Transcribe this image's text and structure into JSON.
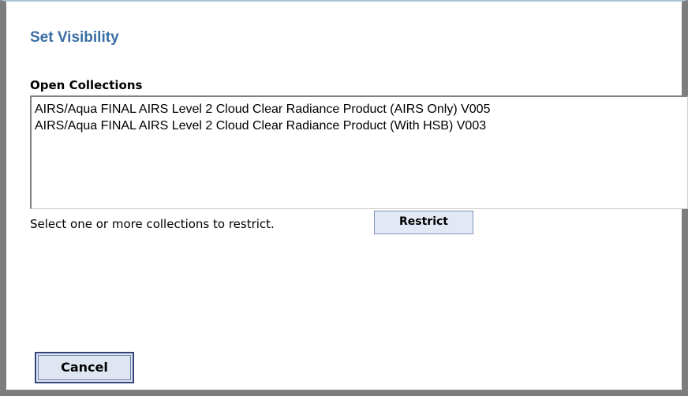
{
  "dialog": {
    "title": "Set Visibility"
  },
  "open_collections": {
    "label": "Open Collections",
    "items": [
      "AIRS/Aqua FINAL AIRS Level 2 Cloud Clear Radiance Product (AIRS Only) V005",
      "AIRS/Aqua FINAL AIRS Level 2 Cloud Clear Radiance Product (With HSB) V003"
    ]
  },
  "restrict": {
    "hint": "Select one or more collections to restrict.",
    "button_label": "Restrict"
  },
  "footer": {
    "cancel_label": "Cancel"
  },
  "colors": {
    "title": "#3a6ea5",
    "frame": "#7d7d7d",
    "button_bg": "#dde4f0"
  }
}
